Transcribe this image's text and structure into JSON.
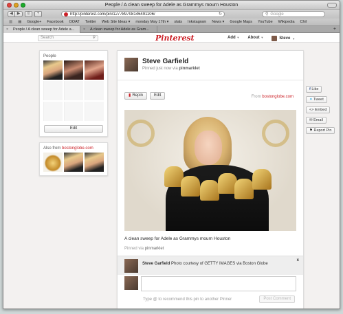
{
  "window": {
    "title": "People / A clean sweep for Adele as Grammys mourn Houston"
  },
  "toolbar": {
    "url": "http://pinterest.com/pin/127789708146491106/",
    "search_placeholder": "Google"
  },
  "bookmarks": [
    "Google+",
    "Facebook",
    "OOAT",
    "Twitter",
    "Web Site Ideas ▾",
    "monday May 17th ▾",
    "stats",
    "Inkstagram",
    "News ▾",
    "Google Maps",
    "YouTube",
    "Wikipedia",
    "Chil"
  ],
  "tabs": [
    {
      "label": "People / A clean sweep for Adele a..."
    },
    {
      "label": "A clean sweep for Adele as Gram..."
    }
  ],
  "header": {
    "search_placeholder": "Search",
    "logo": "Pinterest",
    "nav": {
      "add": "Add",
      "about": "About",
      "user": "Steve"
    }
  },
  "board": {
    "title": "People",
    "edit_label": "Edit",
    "also_from_prefix": "Also from",
    "also_from_source": "bostonglobe.com"
  },
  "pin": {
    "author": "Steve Garfield",
    "pinned_prefix": "Pinned just now via",
    "pinned_via": "pinmarklet",
    "repin_label": "Repin",
    "edit_label": "Edit",
    "from_prefix": "From",
    "from_source": "bostonglobe.com",
    "caption": "A clean sweep for Adele as Grammys mourn Houston",
    "via_prefix": "Pinned via",
    "via": "pinmarklet"
  },
  "comment": {
    "author": "Steve Garfield",
    "text": "Photo courtesy of GETTY IMAGES via Boston Globe",
    "close": "x",
    "hint": "Type @ to recommend this pin to another Pinner",
    "post_label": "Post Comment"
  },
  "share": {
    "like": "Like",
    "tweet": "Tweet",
    "embed": "<> Embed",
    "email": "Email",
    "report": "Report Pin"
  },
  "colors": {
    "brand": "#cb2027",
    "facebook": "#3b5998",
    "twitter": "#2ba9e1"
  }
}
